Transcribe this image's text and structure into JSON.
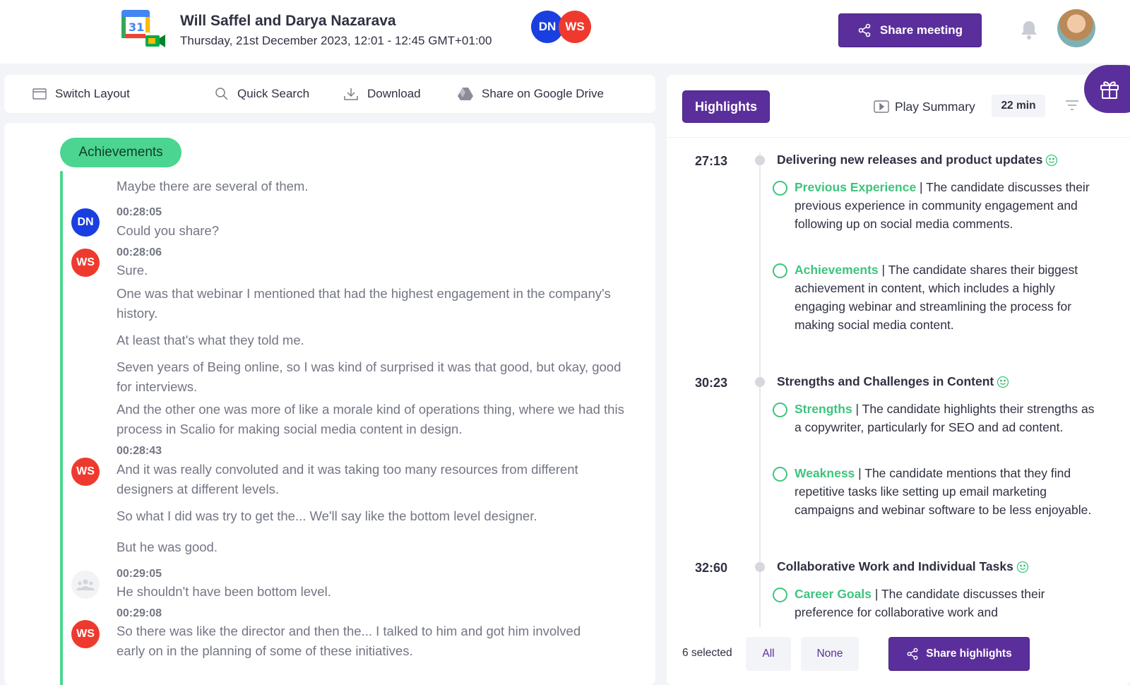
{
  "header": {
    "app_icon": "google-calendar-meet-icon",
    "title": "Will Saffel and Darya Nazarava",
    "subtitle": "Thursday, 21st December 2023, 12:01 - 12:45 GMT+01:00",
    "participants": [
      "DN",
      "WS"
    ],
    "share_meeting_label": "Share meeting",
    "colors": {
      "brand": "#5b2f9b",
      "dn": "#1a3fe0",
      "ws": "#ee3a2e"
    }
  },
  "toolbar": {
    "switch_layout": "Switch Layout",
    "quick_search": "Quick Search",
    "download": "Download",
    "share_drive": "Share on Google Drive"
  },
  "transcript": {
    "section_label": "Achievements",
    "section_color": "#4cd590",
    "lines": [
      "Maybe there are several of them.",
      "Could you share?",
      "Sure.",
      "One was that webinar I mentioned that had the highest engagement in the company's history.",
      "At least that's what they told me.",
      "Seven years of Being online, so I was kind of surprised it was that good, but okay, good for interviews.",
      "And the other one was more of like a morale kind of operations thing, where we had this process in Scalio for making social media content in design.",
      "And it was really convoluted and it was taking too many resources from different designers at different levels.",
      "So what I did was try to get the... We'll say like the bottom level designer.",
      "But he was good.",
      "He shouldn't have been bottom level.",
      "So there was like the director and then the... I talked to him and got him involved early on in the planning of some of these initiatives."
    ],
    "timestamps": [
      "00:28:05",
      "00:28:06",
      "00:28:43",
      "00:29:05",
      "00:29:08"
    ],
    "speakers": [
      "DN",
      "WS",
      "WS",
      "",
      "WS"
    ]
  },
  "highlights": {
    "tab_label": "Highlights",
    "play_summary": "Play Summary",
    "duration": "22 min",
    "groups": [
      {
        "time": "27:13",
        "title": "Delivering new releases and product updates",
        "items": [
          {
            "tag": "Previous Experience",
            "text": " | The candidate discusses their previous experience in community engagement and following up on social media comments."
          },
          {
            "tag": "Achievements",
            "text": " | The candidate shares their biggest achievement in content, which includes a highly engaging webinar and streamlining the process for making social media content."
          }
        ]
      },
      {
        "time": "30:23",
        "title": "Strengths and Challenges in Content",
        "items": [
          {
            "tag": "Strengths",
            "text": " | The candidate highlights their strengths as a copywriter, particularly for SEO and ad content."
          },
          {
            "tag": "Weakness",
            "text": " | The candidate mentions that they find repetitive tasks like setting up email marketing campaigns and webinar software to be less enjoyable."
          }
        ]
      },
      {
        "time": "32:60",
        "title": "Collaborative Work and Individual Tasks",
        "items": [
          {
            "tag": "Career Goals",
            "text": " | The candidate discusses their preference for collaborative work and"
          }
        ]
      }
    ],
    "footer": {
      "selected": "6 selected",
      "all": "All",
      "none": "None",
      "share_highlights": "Share highlights"
    }
  }
}
